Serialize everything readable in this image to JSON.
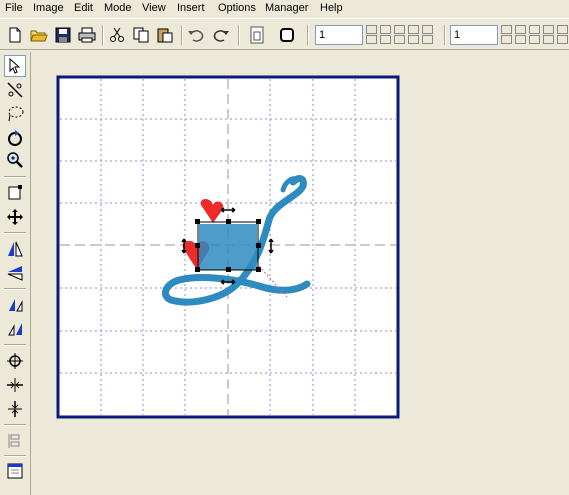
{
  "menu": {
    "items": [
      {
        "label": "File"
      },
      {
        "label": "Image"
      },
      {
        "label": "Edit"
      },
      {
        "label": "Mode"
      },
      {
        "label": "View"
      },
      {
        "label": "Insert"
      },
      {
        "label": "Options"
      },
      {
        "label": "Manager"
      },
      {
        "label": "Help"
      }
    ]
  },
  "toolbar": {
    "icons": [
      "new-document-icon",
      "open-folder-icon",
      "save-icon",
      "print-icon",
      "cut-icon",
      "copy-icon",
      "paste-icon",
      "undo-icon",
      "redo-icon",
      "page-icon",
      "stop-icon"
    ],
    "field1": {
      "value": "1"
    },
    "field2": {
      "value": "1"
    }
  },
  "left_toolbar": {
    "icons": [
      "select-arrow-icon",
      "knife-icon",
      "lasso-icon",
      "rotate-icon",
      "zoom-icon",
      "resize-box-icon",
      "move-icon",
      "mirror-horizontal-icon",
      "mirror-vertical-icon",
      "skew-left-icon",
      "skew-right-icon",
      "center-icon",
      "align-horizontal-icon",
      "align-vertical-icon",
      "stack-icon",
      "window-icon"
    ]
  },
  "design": {
    "letter_color": "#2e8bc0",
    "heart_color": "#ee2b2b",
    "frame_color": "#0a1a7a",
    "grid_color": "#8b8bd6"
  }
}
